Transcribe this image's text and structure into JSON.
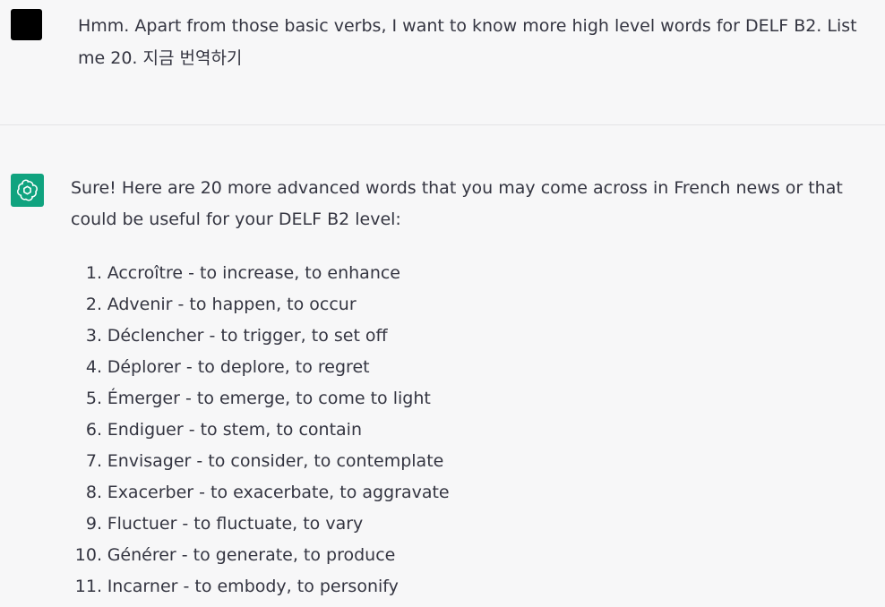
{
  "user_message": {
    "text": "Hmm. Apart from those basic verbs, I want to know more high level words for DELF B2. List me 20. 지금 번역하기"
  },
  "assistant_message": {
    "intro": "Sure! Here are 20 more advanced words that you may come across in French news or that could be useful for your DELF B2 level:",
    "items": [
      {
        "num": "1.",
        "text": "Accroître - to increase, to enhance"
      },
      {
        "num": "2.",
        "text": "Advenir - to happen, to occur"
      },
      {
        "num": "3.",
        "text": "Déclencher - to trigger, to set off"
      },
      {
        "num": "4.",
        "text": "Déplorer - to deplore, to regret"
      },
      {
        "num": "5.",
        "text": "Émerger - to emerge, to come to light"
      },
      {
        "num": "6.",
        "text": "Endiguer - to stem, to contain"
      },
      {
        "num": "7.",
        "text": "Envisager - to consider, to contemplate"
      },
      {
        "num": "8.",
        "text": "Exacerber - to exacerbate, to aggravate"
      },
      {
        "num": "9.",
        "text": "Fluctuer - to fluctuate, to vary"
      },
      {
        "num": "10.",
        "text": "Générer - to generate, to produce"
      },
      {
        "num": "11.",
        "text": "Incarner - to embody, to personify"
      }
    ]
  },
  "icons": {
    "user_avatar": "user-avatar-icon",
    "assistant_avatar": "openai-logo-icon"
  },
  "colors": {
    "assistant_avatar_bg": "#10a37f",
    "user_avatar_bg": "#000000",
    "text": "#343541",
    "background": "#f7f7f8"
  }
}
